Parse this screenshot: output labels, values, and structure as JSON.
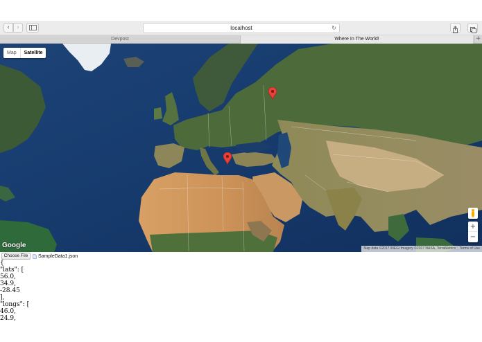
{
  "browser": {
    "url": "localhost",
    "tabs": [
      {
        "label": "Devpost",
        "active": false
      },
      {
        "label": "Where In The World!",
        "active": true
      }
    ]
  },
  "map": {
    "type_buttons": {
      "map": "Map",
      "satellite": "Satellite"
    },
    "selected_type": "Satellite",
    "markers": [
      {
        "label": "marker-moscow",
        "color": "#e8413a"
      },
      {
        "label": "marker-crete",
        "color": "#e8413a"
      }
    ],
    "logo": "Google",
    "attribution": "Map data ©2017 INEGI Imagery ©2017 NASA, TerraMetrics",
    "terms": "Terms of Use",
    "zoom_in": "+",
    "zoom_out": "−"
  },
  "file_input": {
    "button_label": "Choose File",
    "file_name": "SampleData1.json"
  },
  "json_output": {
    "lines": [
      "{",
      "\"lats\": [",
      "56.0,",
      "34.9,",
      "-28.45",
      "],",
      "\"longs\": [",
      "46.0,",
      "24.9,"
    ]
  }
}
